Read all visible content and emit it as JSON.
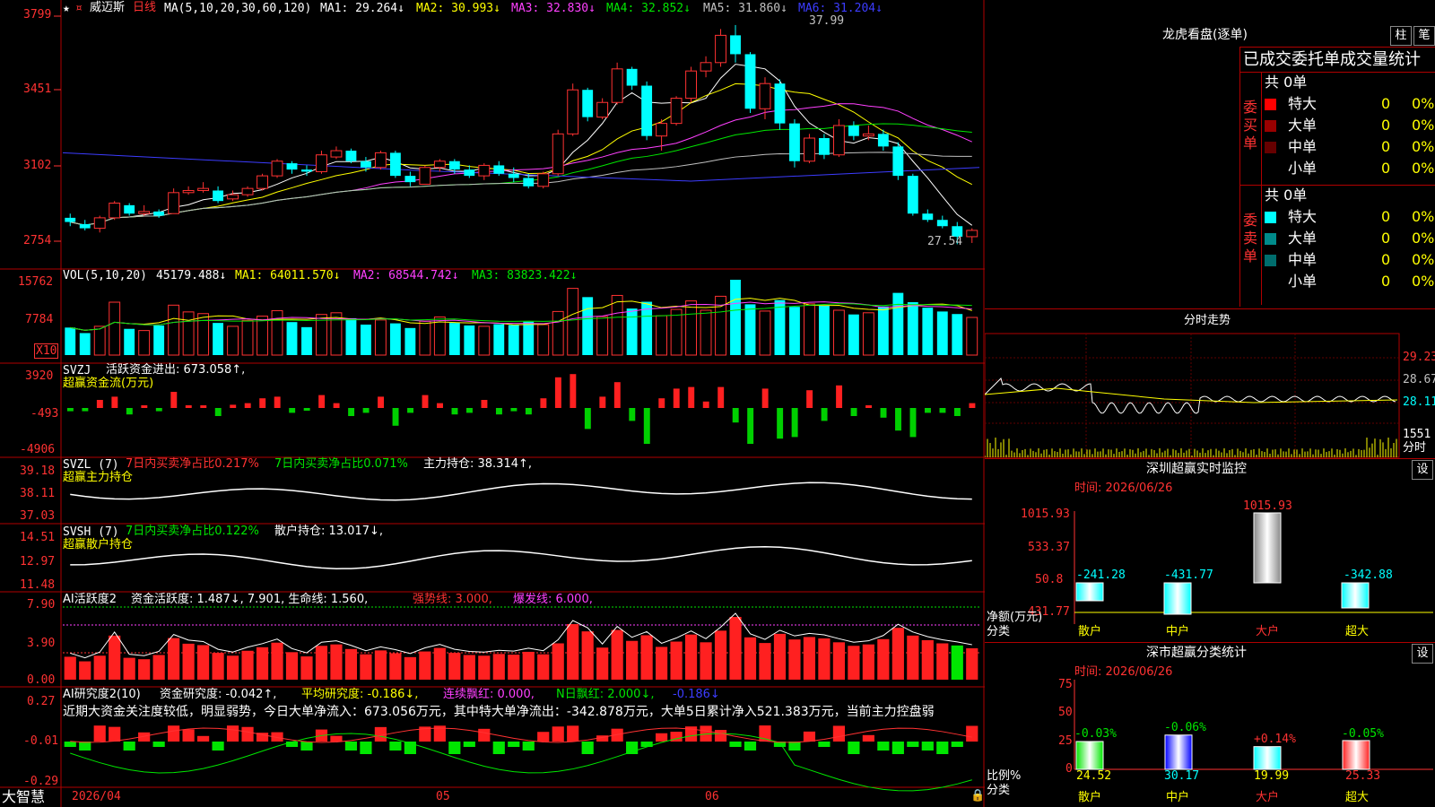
{
  "header": {
    "stock_name": "威迈斯",
    "period": "日线",
    "ma_label": "MA(5,10,20,30,60,120)",
    "ma1": "MA1: 29.264↓",
    "ma2": "MA2: 30.993↓",
    "ma3": "MA3: 32.830↓",
    "ma4": "MA4: 32.852↓",
    "ma5": "MA5: 31.860↓",
    "ma6": "MA6: 31.204↓",
    "high_mark": "37.99",
    "low_mark": "27.54"
  },
  "price_axis": [
    "3799",
    "3451",
    "3102",
    "2754"
  ],
  "vol": {
    "label": "VOL(5,10,20)",
    "value": "45179.488↓",
    "ma1": "MA1: 64011.570↓",
    "ma2": "MA2: 68544.742↓",
    "ma3": "MA3: 83823.422↓",
    "axis": [
      "15762",
      "7784"
    ],
    "unit": "X10"
  },
  "svzj": {
    "label": "SVZJ",
    "title": "活跃资金进出: 673.058↑,",
    "sub": "超赢资金流(万元)",
    "axis": [
      "3920",
      "-493",
      "-4906"
    ]
  },
  "svzl": {
    "label": "SVZL (7)",
    "t1": "7日内买卖净占比0.217%",
    "t2": "7日内买卖净占比0.071%",
    "t3": "主力持仓: 38.314↑,",
    "sub": "超赢主力持仓",
    "axis": [
      "39.18",
      "38.11",
      "37.03"
    ]
  },
  "svsh": {
    "label": "SVSH (7)",
    "t1": "7日内买卖净占比0.122%",
    "t2": "散户持仓: 13.017↓,",
    "sub": "超赢散户持仓",
    "axis": [
      "14.51",
      "12.97",
      "11.48"
    ]
  },
  "ai1": {
    "label": "AI活跃度2",
    "t1": "资金活跃度: 1.487↓, 7.901, 生命线: 1.560,",
    "t2": "强势线: 3.000,",
    "t3": "爆发线: 6.000,",
    "axis": [
      "7.90",
      "3.90",
      "0.00"
    ]
  },
  "ai2": {
    "label": "AI研究度2(10)",
    "t1": "资金研究度: -0.042↑,",
    "t2": "平均研究度: -0.186↓,",
    "t3": "连续飘红: 0.000,",
    "t4": "N日飘红: 2.000↓,",
    "t5": "-0.186↓",
    "comment": "近期大资金关注度较低，明显弱势，今日大单净流入：673.056万元，其中特大单净流出：-342.878万元，大单5日累计净入521.383万元，当前主力控盘弱",
    "axis": [
      "0.27",
      "-0.01",
      "-0.29"
    ]
  },
  "bottom": {
    "brand": "大智慧",
    "date": "2026/04",
    "m05": "05",
    "m06": "06"
  },
  "right": {
    "lhb_title": "龙虎看盘(逐单)",
    "btn_bar": "柱",
    "btn_pen": "笔",
    "stats_title": "已成交委托单成交量统计",
    "buy_label": "委买单",
    "sell_label": "委卖单",
    "buy_total": "共 0单",
    "sell_total": "共 0单",
    "buy_rows": [
      {
        "name": "特大",
        "count": "0",
        "pct": "0%",
        "color": "#ff0000"
      },
      {
        "name": "大单",
        "count": "0",
        "pct": "0%",
        "color": "#990000"
      },
      {
        "name": "中单",
        "count": "0",
        "pct": "0%",
        "color": "#660000"
      },
      {
        "name": "小单",
        "count": "0",
        "pct": "0%",
        "color": "#000000"
      }
    ],
    "sell_rows": [
      {
        "name": "特大",
        "count": "0",
        "pct": "0%",
        "color": "#00ffff"
      },
      {
        "name": "大单",
        "count": "0",
        "pct": "0%",
        "color": "#008b8b"
      },
      {
        "name": "中单",
        "count": "0",
        "pct": "0%",
        "color": "#006d6d"
      },
      {
        "name": "小单",
        "count": "0",
        "pct": "0%",
        "color": "#000000"
      }
    ],
    "fs_title": "分时走势",
    "fs_axis": [
      "29.23",
      "28.67",
      "28.11",
      "1551"
    ],
    "fs_unit": "分时",
    "sz_title": "深圳超赢实时监控",
    "sz_set": "设",
    "sz_date": "时间: 2026/06/26",
    "sz_axis": [
      "1015.93",
      "533.37",
      "50.8",
      "-431.77"
    ],
    "sz_top": "1015.93",
    "sz_vals": [
      "-241.28",
      "-431.77",
      "-342.88"
    ],
    "sz_ylabel": "净额(万元)",
    "sz_xlabel": "分类",
    "cats": [
      "散户",
      "中户",
      "大户",
      "超大"
    ],
    "sc_title": "深市超赢分类统计",
    "sc_set": "设",
    "sc_date": "时间: 2026/06/26",
    "sc_axis": [
      "75",
      "50",
      "25",
      "0"
    ],
    "sc_pcts": [
      "-0.03%",
      "-0.06%",
      "+0.14%",
      "-0.05%"
    ],
    "sc_vals": [
      "24.52",
      "30.17",
      "19.99",
      "25.33"
    ],
    "sc_ylabel": "比例%",
    "sc_xlabel": "分类"
  },
  "chart_data": {
    "type": "candlestick",
    "dates": [
      "2026/04",
      "05",
      "06"
    ],
    "ohlc": [
      [
        28.8,
        29.0,
        28.4,
        28.6
      ],
      [
        28.5,
        28.7,
        28.2,
        28.3
      ],
      [
        28.3,
        28.9,
        28.1,
        28.8
      ],
      [
        28.8,
        29.6,
        28.7,
        29.5
      ],
      [
        29.4,
        29.5,
        28.9,
        29.0
      ],
      [
        29.0,
        29.4,
        28.9,
        29.1
      ],
      [
        29.1,
        29.2,
        28.8,
        28.9
      ],
      [
        29.0,
        30.2,
        29.0,
        30.0
      ],
      [
        30.0,
        30.3,
        29.9,
        30.1
      ],
      [
        30.1,
        30.5,
        30.0,
        30.2
      ],
      [
        30.1,
        30.3,
        29.5,
        29.6
      ],
      [
        29.7,
        30.1,
        29.6,
        29.9
      ],
      [
        29.9,
        30.3,
        29.8,
        30.2
      ],
      [
        30.2,
        30.9,
        30.1,
        30.8
      ],
      [
        30.8,
        31.6,
        30.7,
        31.5
      ],
      [
        31.4,
        31.5,
        30.9,
        31.1
      ],
      [
        31.1,
        31.3,
        30.8,
        31.0
      ],
      [
        31.0,
        32.0,
        30.9,
        31.8
      ],
      [
        31.7,
        32.2,
        31.6,
        32.0
      ],
      [
        32.0,
        32.1,
        31.4,
        31.5
      ],
      [
        31.5,
        31.7,
        31.0,
        31.2
      ],
      [
        31.2,
        32.0,
        31.1,
        31.9
      ],
      [
        31.9,
        32.0,
        30.7,
        30.8
      ],
      [
        30.8,
        31.0,
        30.3,
        30.5
      ],
      [
        30.4,
        31.3,
        30.4,
        31.2
      ],
      [
        31.2,
        31.6,
        31.0,
        31.5
      ],
      [
        31.5,
        31.6,
        30.9,
        31.1
      ],
      [
        31.1,
        31.3,
        30.7,
        30.8
      ],
      [
        30.8,
        31.4,
        30.6,
        31.3
      ],
      [
        31.3,
        31.5,
        30.8,
        30.9
      ],
      [
        30.9,
        31.2,
        30.5,
        30.7
      ],
      [
        30.7,
        30.9,
        30.2,
        30.3
      ],
      [
        30.3,
        31.0,
        30.2,
        30.9
      ],
      [
        30.9,
        33.0,
        30.8,
        32.8
      ],
      [
        32.8,
        35.2,
        32.7,
        34.9
      ],
      [
        34.9,
        35.0,
        33.4,
        33.6
      ],
      [
        33.6,
        34.5,
        33.5,
        34.3
      ],
      [
        34.3,
        36.2,
        34.2,
        35.9
      ],
      [
        35.9,
        36.0,
        34.9,
        35.1
      ],
      [
        35.1,
        35.3,
        32.5,
        32.7
      ],
      [
        32.7,
        33.5,
        32.0,
        33.3
      ],
      [
        33.3,
        34.6,
        33.2,
        34.5
      ],
      [
        34.5,
        36.0,
        34.3,
        35.8
      ],
      [
        35.8,
        36.5,
        35.5,
        36.2
      ],
      [
        36.2,
        37.8,
        36.0,
        37.5
      ],
      [
        37.5,
        37.99,
        36.2,
        36.6
      ],
      [
        36.6,
        36.7,
        33.8,
        34.0
      ],
      [
        34.0,
        35.5,
        33.5,
        35.2
      ],
      [
        35.2,
        35.4,
        33.0,
        33.3
      ],
      [
        33.3,
        33.5,
        31.2,
        31.5
      ],
      [
        31.5,
        32.8,
        31.4,
        32.6
      ],
      [
        32.6,
        32.8,
        31.6,
        31.8
      ],
      [
        31.8,
        33.5,
        31.7,
        33.2
      ],
      [
        33.2,
        33.4,
        32.5,
        32.7
      ],
      [
        32.7,
        33.2,
        32.5,
        32.8
      ],
      [
        32.8,
        33.0,
        32.0,
        32.2
      ],
      [
        32.2,
        32.4,
        30.6,
        30.8
      ],
      [
        30.8,
        30.9,
        28.9,
        29.0
      ],
      [
        29.0,
        29.2,
        28.6,
        28.7
      ],
      [
        28.7,
        28.9,
        28.3,
        28.4
      ],
      [
        28.4,
        28.6,
        27.54,
        27.9
      ],
      [
        27.9,
        28.3,
        27.6,
        28.2
      ]
    ],
    "volume": [
      6500,
      5200,
      6800,
      12500,
      6200,
      5800,
      7000,
      11800,
      10200,
      9800,
      7600,
      6800,
      8200,
      9200,
      10500,
      7800,
      6600,
      9600,
      10000,
      8700,
      7200,
      8300,
      7500,
      6400,
      8000,
      9000,
      7600,
      7000,
      6800,
      7300,
      7100,
      7900,
      7200,
      10300,
      15762,
      13700,
      9100,
      14100,
      11000,
      12600,
      9300,
      10800,
      12800,
      10600,
      13900,
      17800,
      12000,
      10400,
      13000,
      11400,
      12100,
      11700,
      10600,
      9600,
      10000,
      11500,
      14700,
      12500,
      11200,
      10300,
      9700,
      8900
    ],
    "ylabel_price": "",
    "price_range": [
      27.54,
      37.99
    ]
  }
}
